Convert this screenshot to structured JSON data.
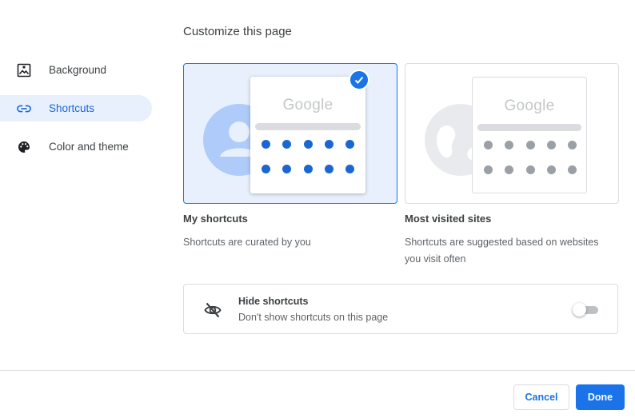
{
  "dialog": {
    "title": "Customize this page"
  },
  "sidebar": {
    "items": [
      {
        "label": "Background",
        "icon": "background-icon",
        "active": false
      },
      {
        "label": "Shortcuts",
        "icon": "link-icon",
        "active": true
      },
      {
        "label": "Color and theme",
        "icon": "palette-icon",
        "active": false
      }
    ]
  },
  "options": [
    {
      "title": "My shortcuts",
      "description": "Shortcuts are curated by you",
      "preview_logo": "Google",
      "selected": true
    },
    {
      "title": "Most visited sites",
      "description": "Shortcuts are suggested based on websites you visit often",
      "preview_logo": "Google",
      "selected": false
    }
  ],
  "hide_shortcuts": {
    "title": "Hide shortcuts",
    "description": "Don't show shortcuts on this page",
    "enabled": false
  },
  "footer": {
    "cancel_label": "Cancel",
    "done_label": "Done"
  },
  "colors": {
    "accent": "#1a73e8",
    "selected_bg": "#e8f0fe",
    "text_primary": "#3c4043",
    "text_secondary": "#5f6368"
  }
}
